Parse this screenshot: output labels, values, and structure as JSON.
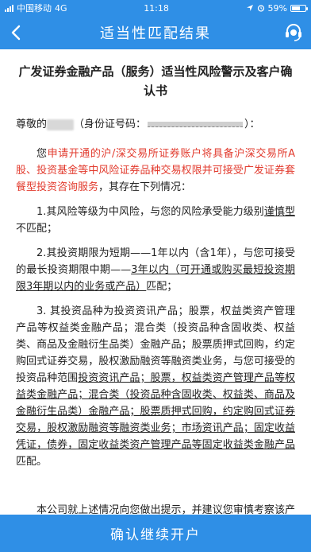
{
  "status": {
    "carrier": "中国移动",
    "network": "4G",
    "time": "11:18",
    "battery": "59%"
  },
  "nav": {
    "title": "适当性匹配结果"
  },
  "doc": {
    "title": "广发证券金融产品（服务）适当性风险警示及客户确认书",
    "greeting_prefix": "尊敬的",
    "greeting_id": "（身份证号码：",
    "greeting_suffix": "）：",
    "p0_a": "您",
    "p0_red": "申请开通的沪/深交易所证券账户将具备沪深交易所A股、投资基金等中风险证券品种交易权限并可接受广发证券套餐型投资咨询服务",
    "p0_b": "，其存在下列情况：",
    "p1_a": "1.其风险等级为中风险，与您的风险承受能力级别",
    "p1_u": "谨慎型",
    "p1_b": "不匹配；",
    "p2_a": "2.其投资期限为短期——1年以内（含1年），与您可接受的最长投资期限中期——",
    "p2_u": "3年以内（可开通或购买最短投资期限3年期以内的业务或产品）",
    "p2_b": "匹配；",
    "p3_a": "3. 其投资品种为投资资讯产品；股票，权益类资产管理产品等权益类金融产品；混合类（投资品种含固收类、权益类、商品及金融衍生品类）金融产品；股票质押式回购，约定购回式证券交易，股权激励融资等融资类业务，与您可接受的投资品种范围",
    "p3_u": "投资资讯产品；股票，权益类资产管理产品等权益类金融产品；混合类（投资品种含固收类、权益类、商品及金融衍生品类）金融产品；股票质押式回购，约定购回式证券交易，股权激励融资等融资类业务；市场资讯产品；固定收益凭证，债券，固定收益类资产管理产品等固定收益类金融产品",
    "p3_b": "匹配。",
    "p4": "本公司就上述情况向您做出提示，并建议您审慎考察该产品或服务的特征及风险，自行做出充分风险评估。请确认以下内容"
  },
  "footer": {
    "confirm_label": "确认继续开户"
  },
  "colors": {
    "brand": "#2f8fe6",
    "warning_red": "#e23b2e"
  },
  "icons": [
    "signal-icon",
    "location-icon",
    "alarm-icon",
    "battery-icon",
    "back-arrow-icon",
    "customer-service-icon"
  ]
}
